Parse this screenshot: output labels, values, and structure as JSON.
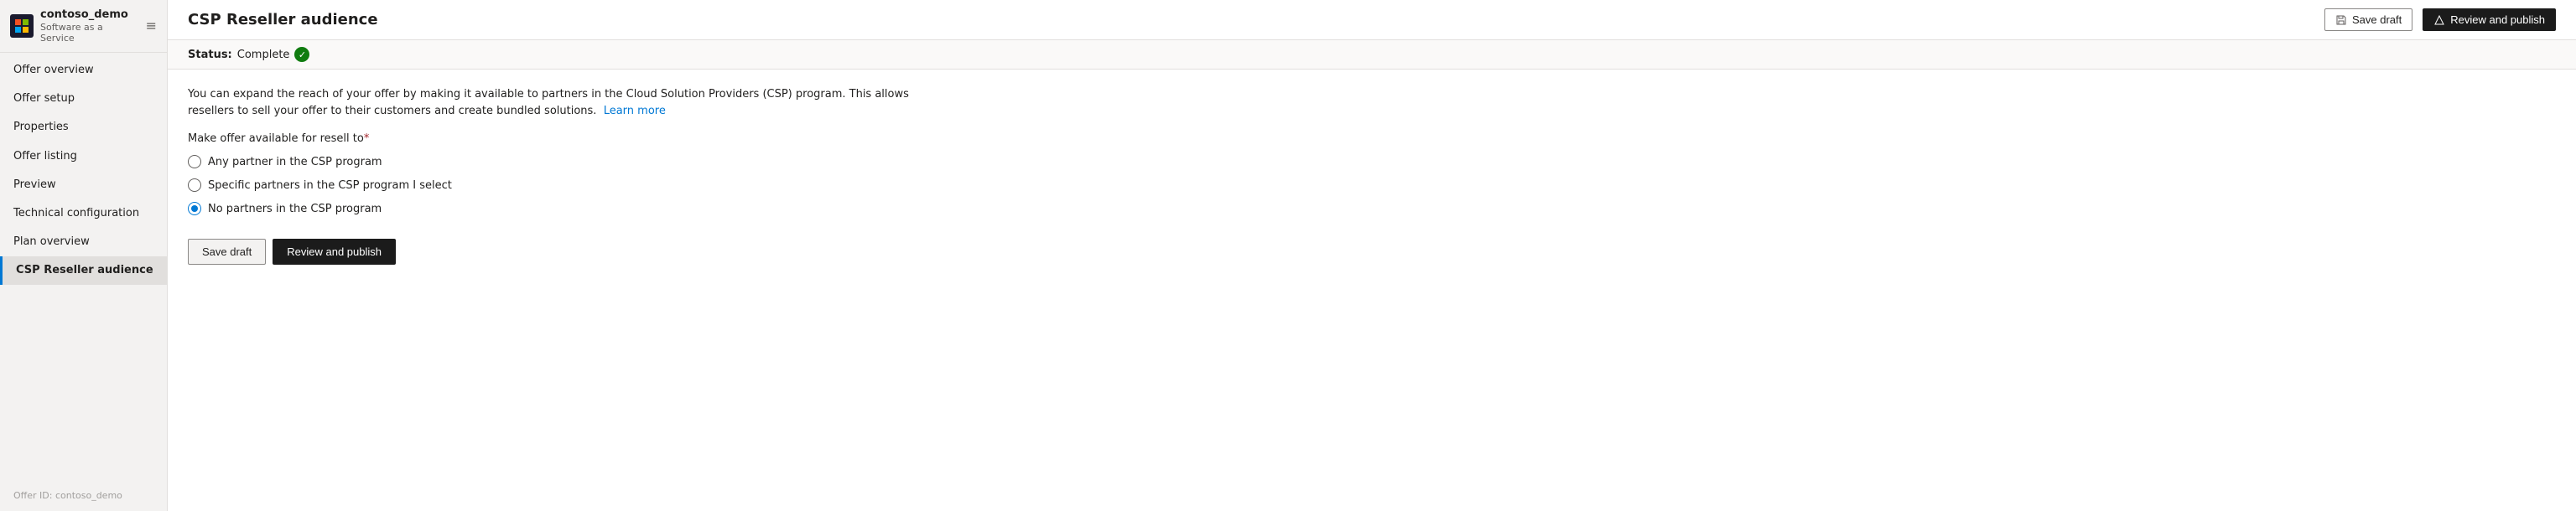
{
  "sidebar": {
    "company_name": "contoso_demo",
    "company_sub": "Software as a Service",
    "nav_items": [
      {
        "id": "offer-overview",
        "label": "Offer overview",
        "active": false
      },
      {
        "id": "offer-setup",
        "label": "Offer setup",
        "active": false
      },
      {
        "id": "properties",
        "label": "Properties",
        "active": false
      },
      {
        "id": "offer-listing",
        "label": "Offer listing",
        "active": false
      },
      {
        "id": "preview",
        "label": "Preview",
        "active": false
      },
      {
        "id": "technical-configuration",
        "label": "Technical configuration",
        "active": false
      },
      {
        "id": "plan-overview",
        "label": "Plan overview",
        "active": false
      },
      {
        "id": "csp-reseller-audience",
        "label": "CSP Reseller audience",
        "active": true
      }
    ],
    "offer_id_label": "Offer ID: contoso_demo"
  },
  "topbar": {
    "title": "CSP Reseller audience",
    "save_draft_label": "Save draft",
    "review_publish_label": "Review and publish"
  },
  "status": {
    "label": "Status:",
    "value": "Complete"
  },
  "description": "You can expand the reach of your offer by making it available to partners in the Cloud Solution Providers (CSP) program. This allows resellers to sell your offer to their customers and create bundled solutions.",
  "learn_more_label": "Learn more",
  "section_label": "Make offer available for resell to",
  "required_marker": "*",
  "radio_options": [
    {
      "id": "any-partner",
      "label": "Any partner in the CSP program",
      "checked": false
    },
    {
      "id": "specific-partners",
      "label": "Specific partners in the CSP program I select",
      "checked": false
    },
    {
      "id": "no-partners",
      "label": "No partners in the CSP program",
      "checked": true
    }
  ],
  "actions": {
    "save_draft_label": "Save draft",
    "review_publish_label": "Review and publish"
  }
}
